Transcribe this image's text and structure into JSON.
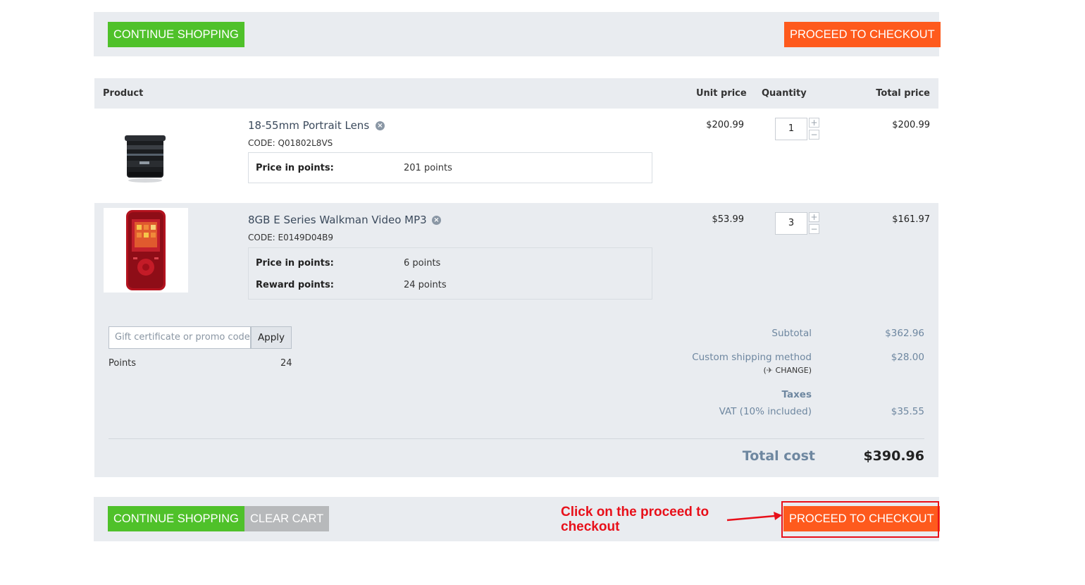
{
  "top_bar": {
    "continue_label": "CONTINUE SHOPPING",
    "checkout_label": "PROCEED TO CHECKOUT"
  },
  "table": {
    "headers": {
      "product": "Product",
      "unit_price": "Unit price",
      "quantity": "Quantity",
      "total_price": "Total price"
    },
    "items": [
      {
        "name": "18-55mm Portrait Lens",
        "code": "CODE: Q01802L8VS",
        "unit_price": "$200.99",
        "quantity": "1",
        "total_price": "$200.99",
        "price_in_points_label": "Price in points:",
        "price_in_points": "201 points"
      },
      {
        "name": "8GB E Series Walkman Video MP3",
        "code": "CODE: E0149D04B9",
        "unit_price": "$53.99",
        "quantity": "3",
        "total_price": "$161.97",
        "price_in_points_label": "Price in points:",
        "price_in_points": "6 points",
        "reward_points_label": "Reward points:",
        "reward_points": "24 points"
      }
    ]
  },
  "summary": {
    "promo_placeholder": "Gift certificate or promo code",
    "apply_label": "Apply",
    "points_label": "Points",
    "points_value": "24",
    "subtotal_label": "Subtotal",
    "subtotal_value": "$362.96",
    "shipping_label": "Custom shipping method",
    "shipping_value": "$28.00",
    "change_label": "CHANGE",
    "taxes_label": "Taxes",
    "vat_label": "VAT (10% included)",
    "vat_value": "$35.55",
    "total_label": "Total cost",
    "total_value": "$390.96"
  },
  "bottom_bar": {
    "continue_label": "CONTINUE SHOPPING",
    "clear_label": "CLEAR CART",
    "checkout_label": "PROCEED TO CHECKOUT"
  },
  "annotation": {
    "text": "Click on the proceed to checkout",
    "color": "#e8101a"
  },
  "colors": {
    "green_button": "#4fc12a",
    "orange_button": "#fe5a1d",
    "gray_button": "#b7b9bb",
    "panel_bg": "#e9ecf0",
    "summary_text": "#6e87a0"
  },
  "icons": [
    "remove-icon",
    "plus-icon",
    "minus-icon",
    "plane-icon"
  ]
}
